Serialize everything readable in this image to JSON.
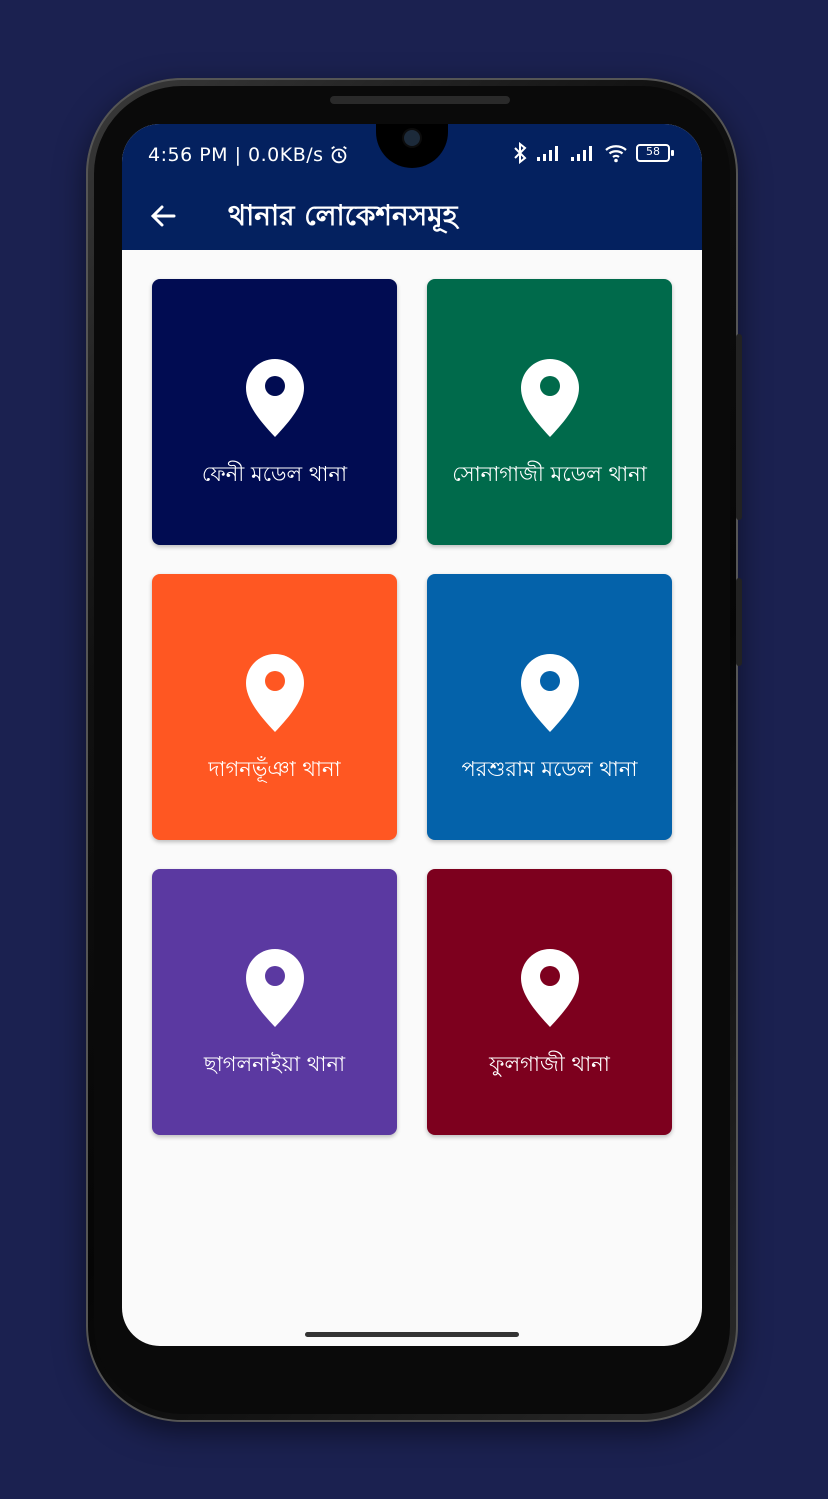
{
  "status_bar": {
    "time_speed": "4:56 PM | 0.0KB/s",
    "battery": "58"
  },
  "app_bar": {
    "title": "থানার লোকেশনসমূহ",
    "back_icon": "arrow-left-icon"
  },
  "cards": [
    {
      "label": "ফেনী মডেল থানা",
      "color": "#010c52",
      "icon": "map-pin-icon"
    },
    {
      "label": "সোনাগাজী মডেল থানা",
      "color": "#006a4b",
      "icon": "map-pin-icon"
    },
    {
      "label": "দাগনভূঁঞা থানা",
      "color": "#ff5722",
      "icon": "map-pin-icon"
    },
    {
      "label": "পরশুরাম মডেল থানা",
      "color": "#0462aa",
      "icon": "map-pin-icon"
    },
    {
      "label": "ছাগলনাইয়া থানা",
      "color": "#5b39a1",
      "icon": "map-pin-icon"
    },
    {
      "label": "ফুলগাজী থানা",
      "color": "#7d001e",
      "icon": "map-pin-icon"
    }
  ],
  "colors": {
    "background": "#1b2150",
    "app_bar": "#04215f",
    "screen": "#fafafa"
  }
}
